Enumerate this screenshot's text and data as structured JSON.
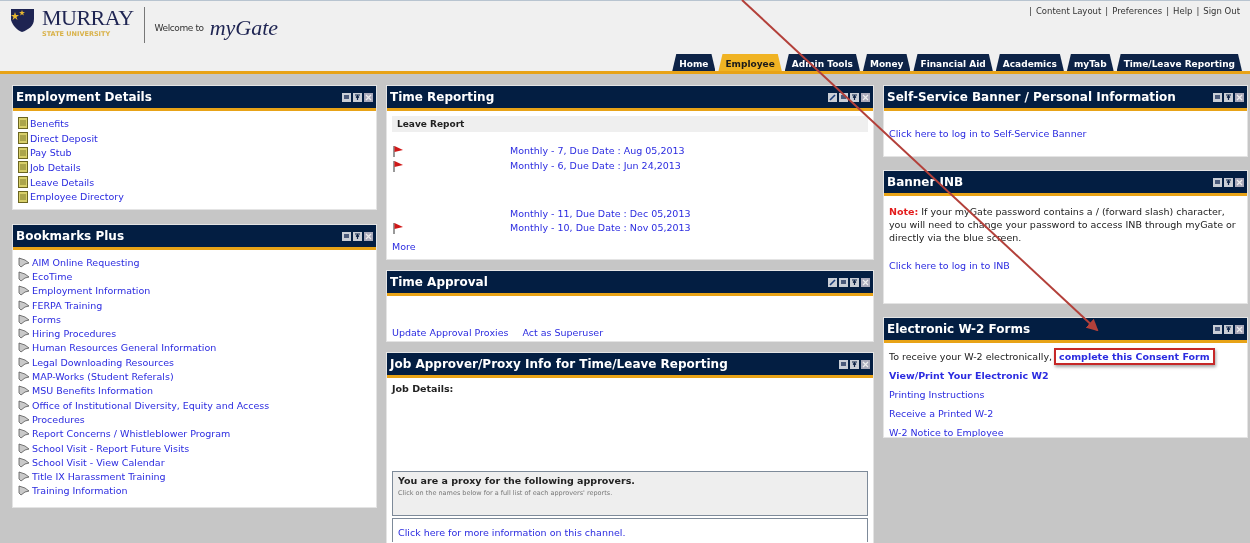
{
  "header": {
    "logo": {
      "name": "MURRAY",
      "sub": "STATE UNIVERSITY"
    },
    "welcome": "Welcome to",
    "brand": "myGate",
    "top_links": [
      "Content Layout",
      "Preferences",
      "Help",
      "Sign Out"
    ],
    "separator": "|"
  },
  "tabs": [
    {
      "label": "Home",
      "selected": false
    },
    {
      "label": "Employee",
      "selected": true
    },
    {
      "label": "Admin Tools",
      "selected": false
    },
    {
      "label": "Money",
      "selected": false
    },
    {
      "label": "Financial Aid",
      "selected": false
    },
    {
      "label": "Academics",
      "selected": false
    },
    {
      "label": "myTab",
      "selected": false
    },
    {
      "label": "Time/Leave Reporting",
      "selected": false
    }
  ],
  "columns": [
    [
      {
        "kind": "links",
        "title": "Employment Details",
        "editable": false,
        "items": [
          "Benefits",
          "Direct Deposit",
          "Pay Stub",
          "Job Details",
          "Leave Details",
          "Employee Directory"
        ]
      },
      {
        "kind": "links",
        "title": "Bookmarks Plus",
        "editable": false,
        "items": [
          "AIM Online Requesting",
          "EcoTime",
          "Employment Information",
          "FERPA Training",
          "Forms",
          "Hiring Procedures",
          "Human Resources General Information",
          "Legal Downloading Resources",
          "MAP-Works (Student Referals)",
          "MSU Benefits Information",
          "Office of Institutional Diversity, Equity and Access",
          "Procedures",
          "Report Concerns / Whistleblower Program",
          "School Visit - Report Future Visits",
          "School Visit - View Calendar",
          "Title IX Harassment Training",
          "Training Information"
        ]
      }
    ],
    [
      {
        "kind": "leave_report",
        "title": "Time Reporting",
        "editable": true,
        "heading": "Leave Report",
        "row_groups": [
          [
            {
              "flag": true,
              "text": "Monthly - 7, Due Date : Aug 05,2013"
            },
            {
              "flag": true,
              "text": "Monthly - 6, Due Date : Jun 24,2013"
            }
          ],
          [
            {
              "flag": false,
              "text": "Monthly - 11, Due Date : Dec 05,2013"
            },
            {
              "flag": true,
              "text": "Monthly - 10, Due Date : Nov 05,2013"
            }
          ]
        ],
        "more": "More"
      },
      {
        "kind": "approval",
        "title": "Time Approval",
        "editable": true,
        "links": [
          "Update Approval Proxies",
          "Act as Superuser"
        ]
      },
      {
        "kind": "proxy",
        "title": "Job Approver/Proxy Info for Time/Leave Reporting",
        "editable": false,
        "label": "Job Details:",
        "proxy_title": "You are a proxy for the following approvers.",
        "proxy_hint": "Click on the names below for a full list of each approvers' reports.",
        "info_link": "Click here for more information on this channel."
      }
    ],
    [
      {
        "kind": "login",
        "title": "Self-Service Banner / Personal Information",
        "editable": false,
        "link": "Click here to log in to Self-Service Banner"
      },
      {
        "kind": "note",
        "title": "Banner INB",
        "editable": false,
        "note_label": "Note:",
        "note_text": "If your myGate password contains a / (forward slash) character, you will need to change your password to access INB through myGate or directly via the blue screen.",
        "link": "Click here to log in to INB"
      },
      {
        "kind": "w2",
        "title": "Electronic W-2 Forms",
        "editable": false,
        "intro": "To receive your W-2 electronically,",
        "consent": {
          "text": "complete this Consent Form",
          "highlighted": true
        },
        "main_link": "View/Print Your Electronic W2",
        "links": [
          "Printing Instructions",
          "Receive a Printed W-2",
          "W-2 Notice to Employee"
        ]
      }
    ]
  ],
  "annotation": {
    "kind": "arrow"
  }
}
